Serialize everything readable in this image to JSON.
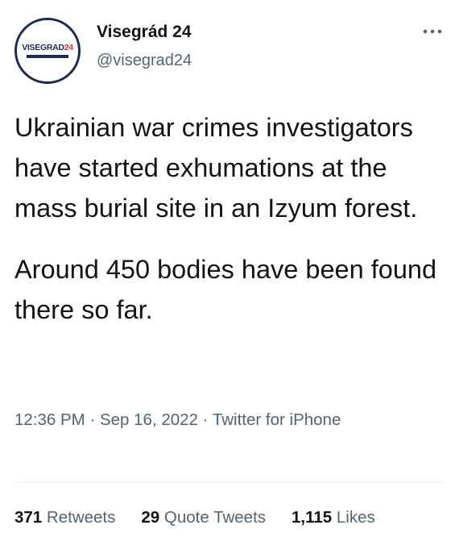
{
  "author": {
    "name": "Visegrád 24",
    "handle": "@visegrad24",
    "avatar_logo_main": "VISEGRAD",
    "avatar_logo_num": "24"
  },
  "tweet": {
    "paragraphs": [
      "Ukrainian war crimes investigators have started exhumations at the mass burial site in an Izyum forest.",
      "Around 450 bodies have been found there so far."
    ]
  },
  "meta": {
    "time": "12:36 PM",
    "date": "Sep 16, 2022",
    "source": "Twitter for iPhone",
    "separator": "·"
  },
  "stats": {
    "retweets_count": "371",
    "retweets_label": "Retweets",
    "quotes_count": "29",
    "quotes_label": "Quote Tweets",
    "likes_count": "1,115",
    "likes_label": "Likes"
  },
  "icons": {
    "more": "more-horizontal-icon"
  },
  "colors": {
    "text_primary": "#0f1419",
    "text_secondary": "#536471",
    "divider": "#eff3f4",
    "logo_navy": "#1f2a5a",
    "logo_red": "#d32f2f"
  }
}
